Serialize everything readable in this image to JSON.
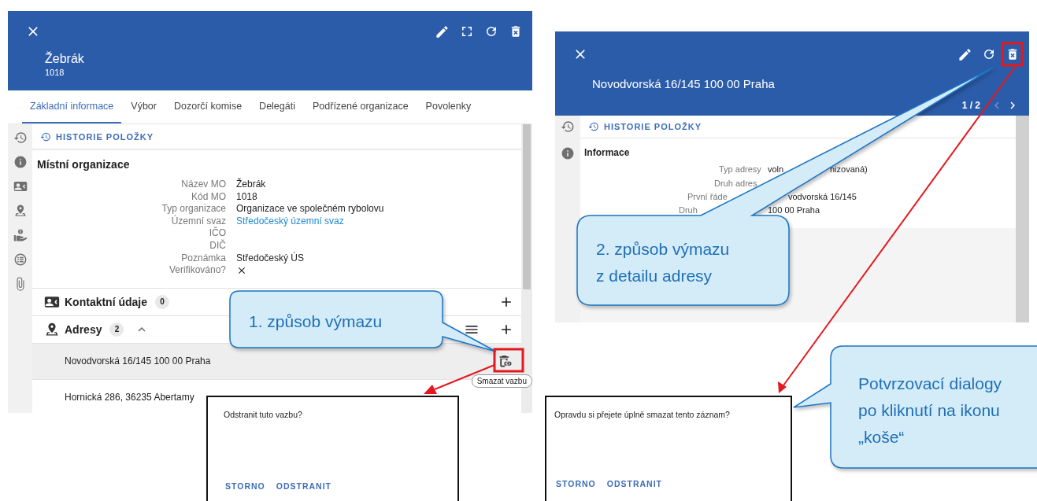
{
  "left_window": {
    "title": "Žebrák",
    "subtitle": "1018",
    "tabs": [
      {
        "label": "Základní informace",
        "selected": true
      },
      {
        "label": "Výbor",
        "selected": false
      },
      {
        "label": "Dozorčí komise",
        "selected": false
      },
      {
        "label": "Delegáti",
        "selected": false
      },
      {
        "label": "Podřízené organizace",
        "selected": false
      },
      {
        "label": "Povolenky",
        "selected": false
      }
    ],
    "history_link": "HISTORIE POLOŽKY",
    "section_title": "Místní organizace",
    "fields": [
      {
        "label": "Název MO",
        "value": "Žebrák",
        "kind": "text"
      },
      {
        "label": "Kód MO",
        "value": "1018",
        "kind": "text"
      },
      {
        "label": "Typ organizace",
        "value": "Organizace ve společném rybolovu",
        "kind": "text"
      },
      {
        "label": "Územní svaz",
        "value": "Středočeský územní svaz",
        "kind": "link"
      },
      {
        "label": "IČO",
        "kind": "text"
      },
      {
        "label": "DIČ",
        "kind": "text"
      },
      {
        "label": "Poznámka",
        "value": "Středočeský ÚS",
        "kind": "text"
      },
      {
        "label": "Verifikováno?",
        "kind": "boolean",
        "checked": false
      }
    ],
    "panels": [
      {
        "title": "Kontaktní údaje",
        "count": "0",
        "expanded": false
      },
      {
        "title": "Adresy",
        "count": "2",
        "expanded": true
      }
    ],
    "addresses": [
      {
        "text": "Novodvorská 16/145 100 00 Praha",
        "selected": true
      },
      {
        "text": "Hornická 286, 36235 Abertamy",
        "selected": false
      }
    ],
    "tooltip": "Smazat vazbu"
  },
  "right_window": {
    "title": "Novodvorská 16/145 100 00 Praha",
    "pager": "1 / 2",
    "history_link": "HISTORIE POLOŽKY",
    "section_title": "Informace",
    "fields": [
      {
        "label": "Typ adresy",
        "value": [
          "voln",
          "nizovaná)"
        ]
      },
      {
        "label": "Druh adres"
      },
      {
        "label": "První řáde",
        "value": [
          "vodvorská 16/145"
        ]
      },
      {
        "label": "Druh",
        "value": [
          "100 00 Praha"
        ]
      }
    ]
  },
  "dialogs": [
    {
      "message": "Odstranit tuto vazbu?",
      "buttons": [
        "STORNO",
        "ODSTRANIT"
      ]
    },
    {
      "message": "Opravdu si přejete úplně smazat tento záznam?",
      "buttons": [
        "STORNO",
        "ODSTRANIT"
      ]
    }
  ],
  "callouts": [
    {
      "lines": [
        "1. způsob výmazu"
      ]
    },
    {
      "lines": [
        "2. způsob výmazu",
        "z detailu adresy"
      ]
    },
    {
      "lines": [
        "Potvrzovací dialogy",
        "po kliknutí na ikonu",
        "„koše“"
      ]
    }
  ]
}
